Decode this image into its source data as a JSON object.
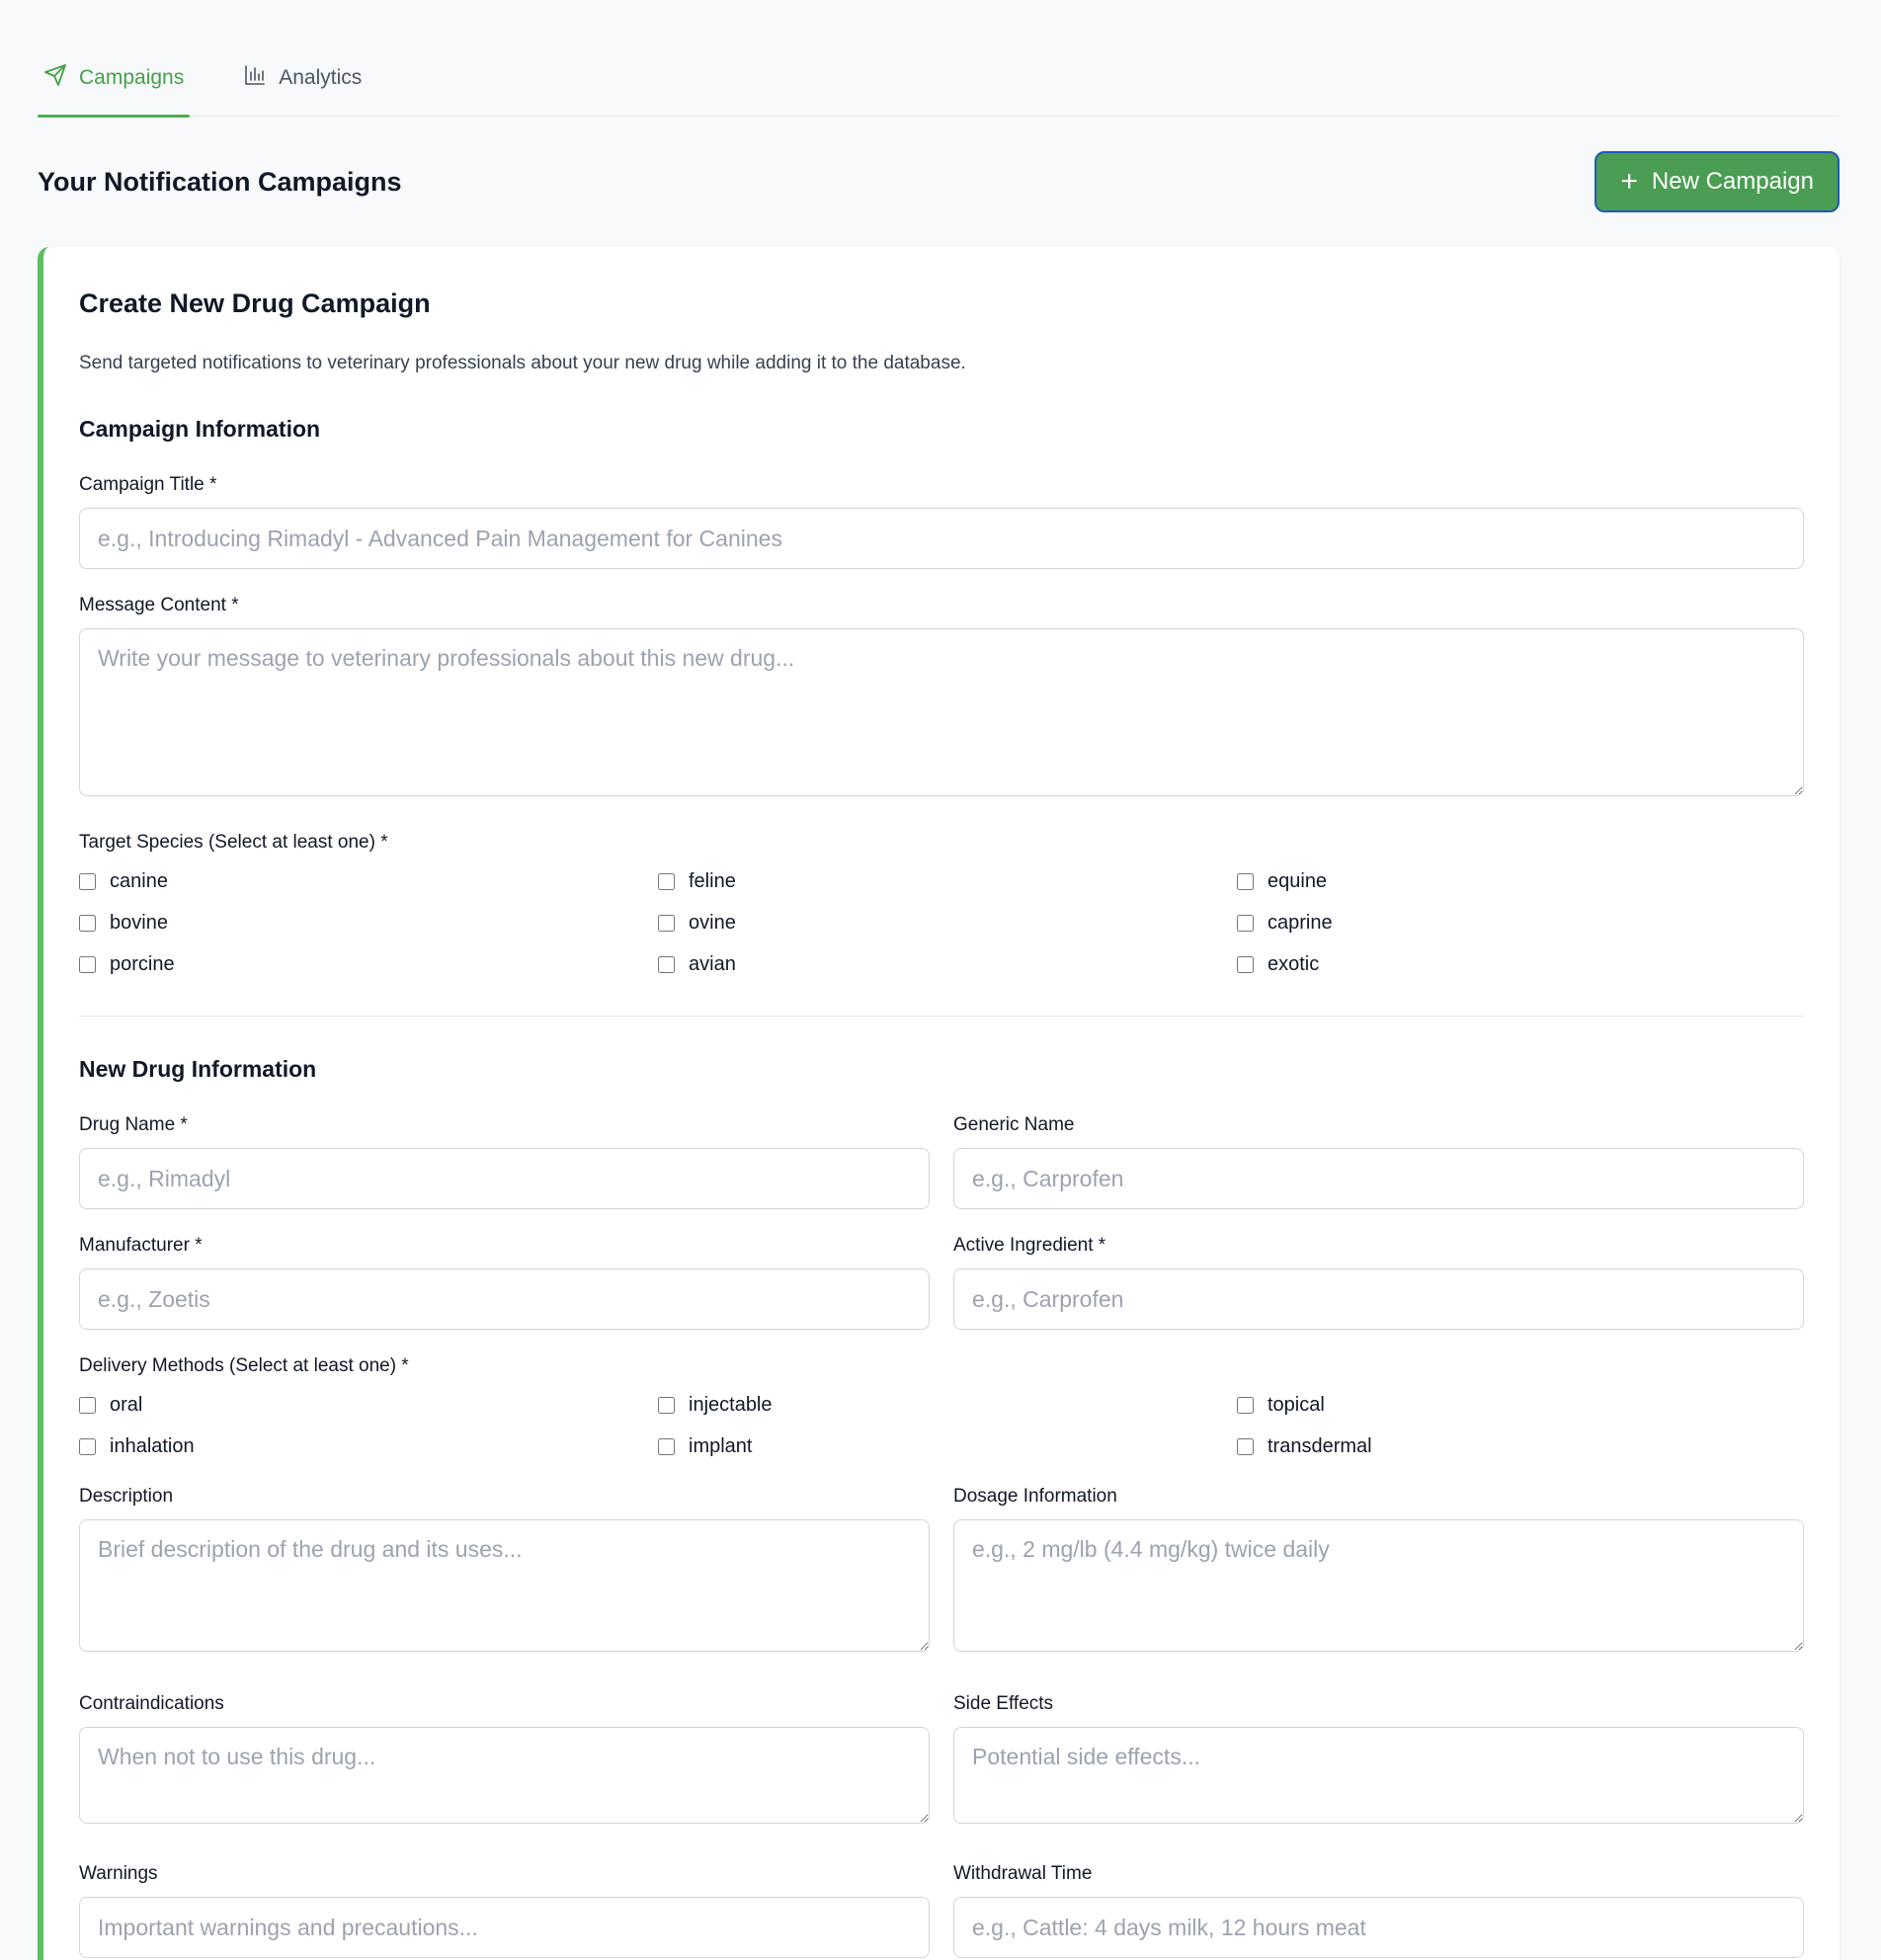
{
  "tabs": [
    {
      "label": "Campaigns",
      "icon": "send-icon",
      "active": true
    },
    {
      "label": "Analytics",
      "icon": "bar-chart-icon",
      "active": false
    }
  ],
  "header": {
    "title": "Your Notification Campaigns",
    "new_button_label": "New Campaign"
  },
  "form": {
    "title": "Create New Drug Campaign",
    "description": "Send targeted notifications to veterinary professionals about your new drug while adding it to the database.",
    "campaign_section": {
      "title": "Campaign Information",
      "campaign_title_label": "Campaign Title *",
      "campaign_title_placeholder": "e.g., Introducing Rimadyl - Advanced Pain Management for Canines",
      "message_label": "Message Content *",
      "message_placeholder": "Write your message to veterinary professionals about this new drug...",
      "species_label": "Target Species (Select at least one) *",
      "species": [
        "canine",
        "feline",
        "equine",
        "bovine",
        "ovine",
        "caprine",
        "porcine",
        "avian",
        "exotic"
      ]
    },
    "drug_section": {
      "title": "New Drug Information",
      "drug_name_label": "Drug Name *",
      "drug_name_placeholder": "e.g., Rimadyl",
      "generic_name_label": "Generic Name",
      "generic_name_placeholder": "e.g., Carprofen",
      "manufacturer_label": "Manufacturer *",
      "manufacturer_placeholder": "e.g., Zoetis",
      "active_ingredient_label": "Active Ingredient *",
      "active_ingredient_placeholder": "e.g., Carprofen",
      "delivery_label": "Delivery Methods (Select at least one) *",
      "delivery_methods": [
        "oral",
        "injectable",
        "topical",
        "inhalation",
        "implant",
        "transdermal"
      ],
      "description_label": "Description",
      "description_placeholder": "Brief description of the drug and its uses...",
      "dosage_label": "Dosage Information",
      "dosage_placeholder": "e.g., 2 mg/lb (4.4 mg/kg) twice daily",
      "contraindications_label": "Contraindications",
      "contraindications_placeholder": "When not to use this drug...",
      "side_effects_label": "Side Effects",
      "side_effects_placeholder": "Potential side effects...",
      "warnings_label": "Warnings",
      "warnings_placeholder": "Important warnings and precautions...",
      "withdrawal_label": "Withdrawal Time",
      "withdrawal_placeholder": "e.g., Cattle: 4 days milk, 12 hours meat"
    }
  },
  "colors": {
    "accent": "#4caf50",
    "button_bg": "#4a9d52",
    "button_border": "#1f5ab8"
  }
}
